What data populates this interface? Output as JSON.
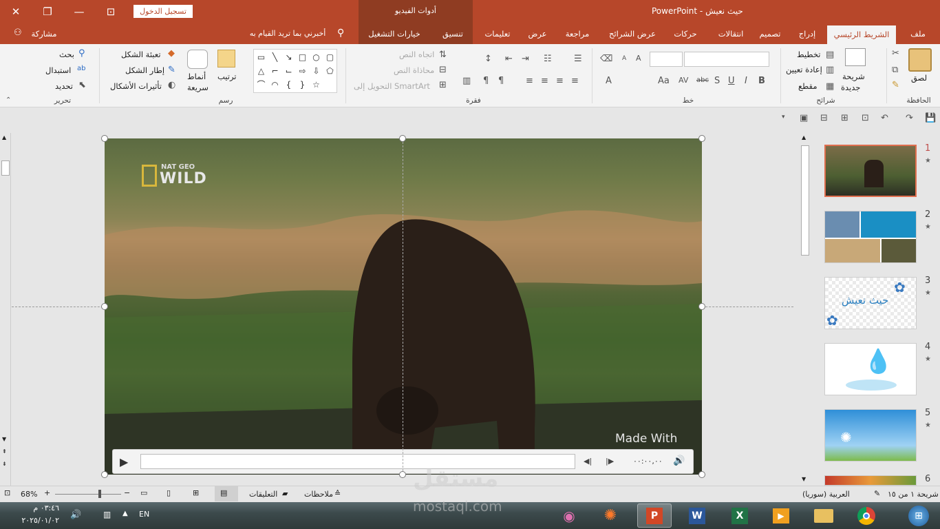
{
  "window": {
    "title": "حيث نعيش",
    "separator": "-",
    "app": "PowerPoint",
    "signin": "تسجيل الدخول",
    "context_group": "أدوات الفيديو"
  },
  "tabs": {
    "file": "ملف",
    "home": "الشريط الرئيسي",
    "insert": "إدراج",
    "design": "تصميم",
    "transitions": "انتقالات",
    "animations": "حركات",
    "slideshow": "عرض الشرائح",
    "review": "مراجعة",
    "view": "عرض",
    "help": "تعليمات",
    "format": "تنسيق",
    "playback": "خيارات التشغيل",
    "tellme": "أخبرني بما تريد القيام به",
    "share": "مشاركة"
  },
  "ribbon": {
    "clipboard": {
      "label": "الحافظة",
      "paste": "لصق"
    },
    "slides": {
      "label": "شرائح",
      "new_slide_1": "شريحة",
      "new_slide_2": "جديدة",
      "layout": "تخطيط",
      "reset": "إعادة تعيين",
      "section": "مقطع"
    },
    "font": {
      "label": "خط",
      "bold": "B",
      "italic": "I",
      "underline": "U",
      "shadow": "S",
      "strike": "abc",
      "spacing": "AV",
      "case": "Aa",
      "color": "A",
      "grow": "A",
      "shrink": "A"
    },
    "paragraph": {
      "label": "فقرة",
      "direction": "اتجاه النص",
      "align": "محاذاة النص",
      "smartart": "التحويل إلى SmartArt"
    },
    "drawing": {
      "label": "رسم",
      "arrange": "ترتيب",
      "styles_1": "أنماط",
      "styles_2": "سريعة",
      "fill": "تعبئة الشكل",
      "outline": "إطار الشكل",
      "effects": "تأثيرات الأشكال"
    },
    "editing": {
      "label": "تحرير",
      "find": "بحث",
      "replace": "استبدال",
      "select": "تحديد"
    }
  },
  "slide": {
    "brand_1": "NAT GEO",
    "brand_2": "WILD",
    "watermark": "Made With",
    "time": "٠٠:٠٠,٠٠"
  },
  "thumbnails": [
    {
      "num": "1",
      "text": ""
    },
    {
      "num": "2",
      "text": ""
    },
    {
      "num": "3",
      "text": "حيث نعيش"
    },
    {
      "num": "4",
      "text": ""
    },
    {
      "num": "5",
      "text": ""
    },
    {
      "num": "6",
      "text": ""
    }
  ],
  "status": {
    "slide_count": "شريحة ١ من ١٥",
    "language": "العربية (سوريا)",
    "notes": "ملاحظات",
    "comments": "التعليقات",
    "zoom": "68%",
    "zoom_fraction": 0.68
  },
  "taskbar": {
    "time": "٠٣:٤٦ م",
    "date": "٢٠٢٥/٠١/٠٢",
    "lang": "EN",
    "watermark_ar": "مستقل",
    "watermark_url": "mostaql.com"
  },
  "colors": {
    "accent": "#b7472a",
    "ribbon": "#f3f3f3"
  }
}
